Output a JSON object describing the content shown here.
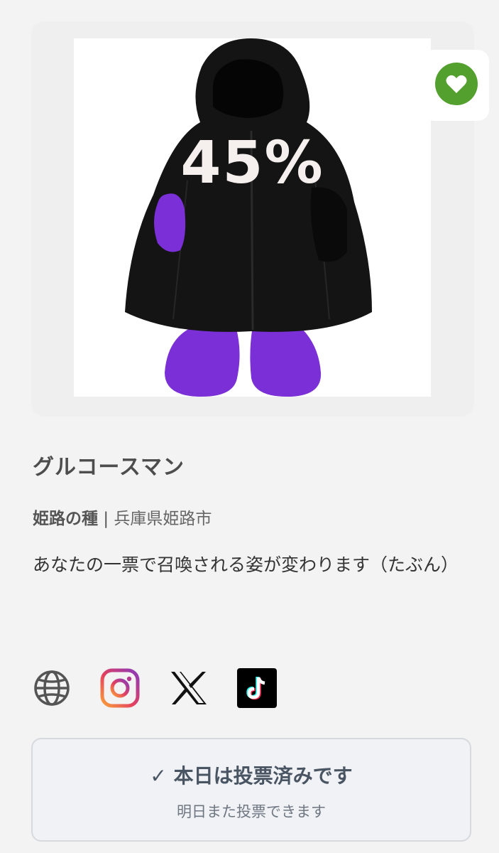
{
  "card": {
    "percent_overlay": "45%",
    "favorite_icon": "heart-icon",
    "favorite_color": "#53a02f"
  },
  "mascot": {
    "name": "グルコースマン",
    "organization": "姫路の種",
    "separator": "|",
    "location": "兵庫県姫路市",
    "description": "あなたの一票で召喚される姿が変わります（たぶん）"
  },
  "social": {
    "icons": [
      "globe-icon",
      "instagram-icon",
      "x-icon",
      "tiktok-icon"
    ]
  },
  "vote": {
    "title": "✓ 本日は投票済みです",
    "subtitle": "明日また投票できます"
  }
}
